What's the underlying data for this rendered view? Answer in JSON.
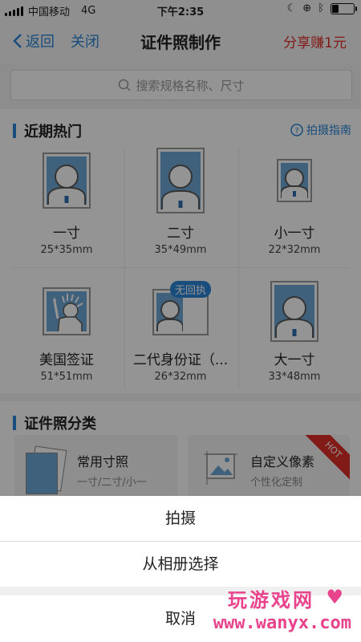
{
  "status_bar": {
    "carrier": "中国移动",
    "network": "4G",
    "time": "下午2:35"
  },
  "nav": {
    "back": "返回",
    "close": "关闭",
    "title": "证件照制作",
    "share": "分享赚1元"
  },
  "search": {
    "placeholder": "搜索规格名称、尺寸"
  },
  "recent": {
    "title": "近期热门",
    "guide": "拍摄指南",
    "items": [
      {
        "label": "一寸",
        "size": "25*35mm"
      },
      {
        "label": "二寸",
        "size": "35*49mm"
      },
      {
        "label": "小一寸",
        "size": "22*32mm"
      },
      {
        "label": "美国签证",
        "size": "51*51mm"
      },
      {
        "label": "二代身份证（...",
        "size": "26*32mm",
        "badge": "无回执"
      },
      {
        "label": "大一寸",
        "size": "33*48mm"
      }
    ]
  },
  "categories": {
    "title": "证件照分类",
    "items": [
      {
        "title": "常用寸照",
        "subtitle": "一寸/二寸/小一"
      },
      {
        "title": "自定义像素",
        "subtitle": "个性化定制",
        "tag": "HOT"
      }
    ]
  },
  "action_sheet": {
    "shoot": "拍摄",
    "album": "从相册选择",
    "cancel": "取消"
  },
  "watermark": {
    "line1": "玩游戏网",
    "line2": "www.wanyx.com"
  },
  "colors": {
    "accent": "#2b86d8",
    "danger": "#e0302a",
    "photo_bg": "#6fa8d6"
  }
}
